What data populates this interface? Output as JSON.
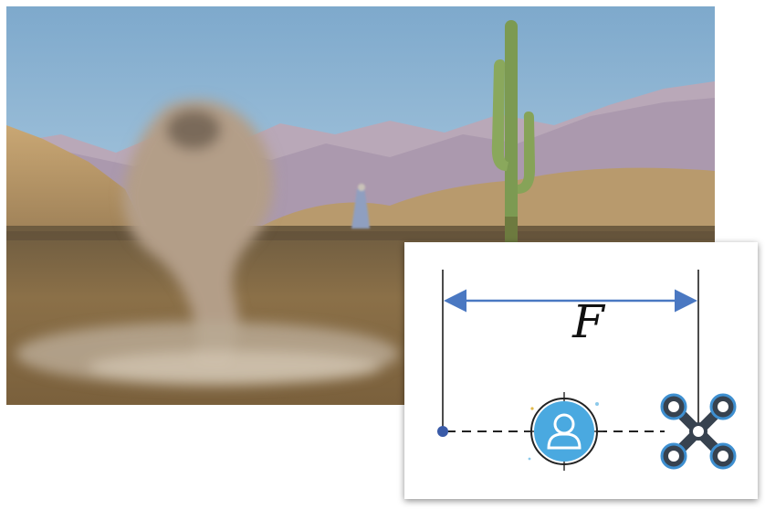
{
  "scene": {
    "subjects": [
      "cobra-snake",
      "person-in-robe",
      "saguaro-cactus",
      "desert-mountains"
    ],
    "sky_color": "#8fb6d6",
    "ground_color": "#8a6f45"
  },
  "diagram": {
    "distance_label": "F",
    "arrow_color": "#4a78c2",
    "marker_color": "#3a5ba8",
    "target_icon_color": "#4aa9e0",
    "icons": [
      "origin-dot",
      "person-target-icon",
      "drone-icon"
    ]
  }
}
